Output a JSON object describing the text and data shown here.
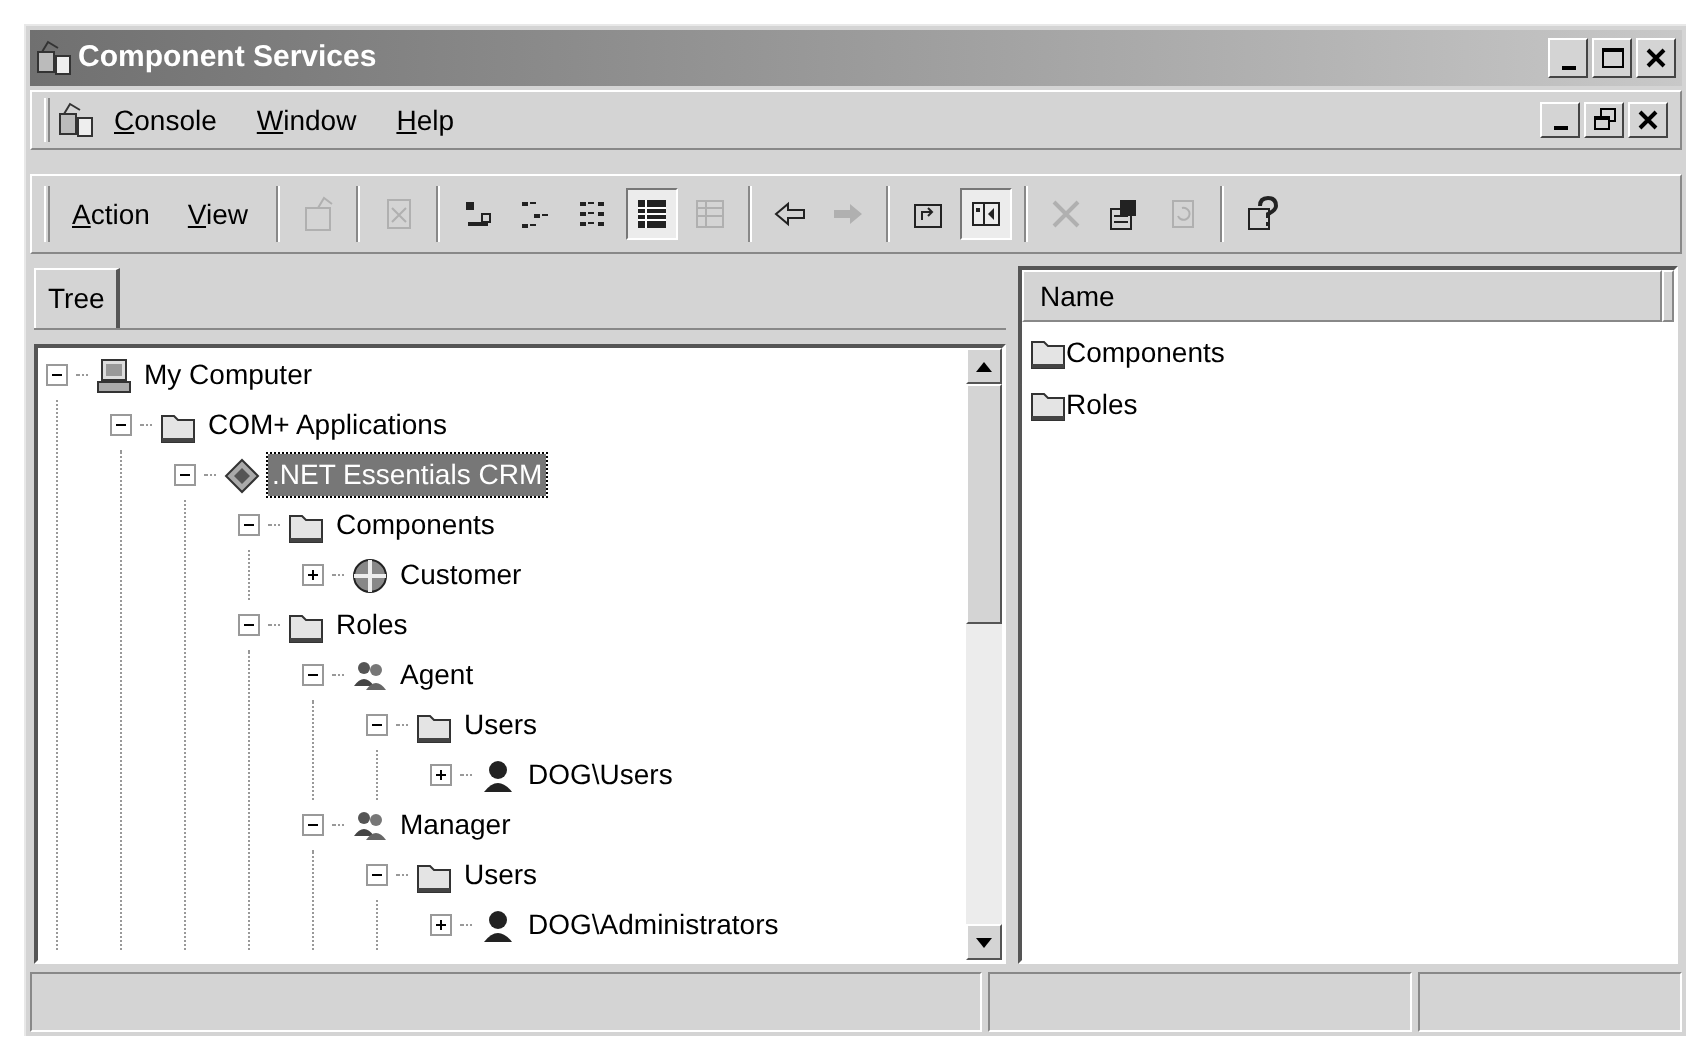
{
  "window": {
    "title": "Component Services",
    "controls": [
      {
        "kind": "minimize"
      },
      {
        "kind": "maximize"
      },
      {
        "kind": "close"
      }
    ]
  },
  "menu_bar": {
    "items": [
      {
        "label": "Console"
      },
      {
        "label": "Window"
      },
      {
        "label": "Help"
      }
    ],
    "child_controls": [
      {
        "kind": "minimize"
      },
      {
        "kind": "restore"
      },
      {
        "kind": "close"
      }
    ]
  },
  "toolbar": {
    "menus": [
      {
        "label": "Action"
      },
      {
        "label": "View"
      }
    ],
    "groups": [
      [
        {
          "kind": "new-window",
          "disabled": true,
          "pressed": false
        }
      ],
      [
        {
          "kind": "export",
          "disabled": true,
          "pressed": false
        }
      ],
      [
        {
          "kind": "large-icons",
          "disabled": false,
          "pressed": false
        },
        {
          "kind": "small-icons",
          "disabled": false,
          "pressed": false
        },
        {
          "kind": "list",
          "disabled": false,
          "pressed": false
        },
        {
          "kind": "details",
          "disabled": false,
          "pressed": true
        },
        {
          "kind": "customize",
          "disabled": true,
          "pressed": false
        }
      ],
      [
        {
          "kind": "back",
          "disabled": false,
          "pressed": false
        },
        {
          "kind": "forward",
          "disabled": true,
          "pressed": false
        }
      ],
      [
        {
          "kind": "up",
          "disabled": false,
          "pressed": false
        },
        {
          "kind": "show-tree",
          "disabled": false,
          "pressed": true
        }
      ],
      [
        {
          "kind": "delete",
          "disabled": true,
          "pressed": false
        },
        {
          "kind": "properties",
          "disabled": false,
          "pressed": false
        },
        {
          "kind": "refresh",
          "disabled": true,
          "pressed": false
        }
      ],
      [
        {
          "kind": "help",
          "disabled": false,
          "pressed": false
        }
      ]
    ]
  },
  "tree_tab": {
    "label": "Tree"
  },
  "tree": [
    {
      "label": "My Computer",
      "kind": "computer",
      "expanded": true,
      "selected": false,
      "children": [
        {
          "label": "COM+ Applications",
          "kind": "folder",
          "expanded": true,
          "selected": false,
          "children": [
            {
              "label": ".NET Essentials CRM",
              "kind": "application",
              "expanded": true,
              "selected": true,
              "children": [
                {
                  "label": "Components",
                  "kind": "folder",
                  "expanded": true,
                  "selected": false,
                  "children": [
                    {
                      "label": "Customer",
                      "kind": "component",
                      "expanded": false,
                      "selected": false
                    }
                  ]
                },
                {
                  "label": "Roles",
                  "kind": "folder",
                  "expanded": true,
                  "selected": false,
                  "children": [
                    {
                      "label": "Agent",
                      "kind": "role",
                      "expanded": true,
                      "selected": false,
                      "children": [
                        {
                          "label": "Users",
                          "kind": "folder",
                          "expanded": true,
                          "selected": false,
                          "children": [
                            {
                              "label": "DOG\\Users",
                              "kind": "user",
                              "expanded": false,
                              "selected": false
                            }
                          ]
                        }
                      ]
                    },
                    {
                      "label": "Manager",
                      "kind": "role",
                      "expanded": true,
                      "selected": false,
                      "children": [
                        {
                          "label": "Users",
                          "kind": "folder",
                          "expanded": true,
                          "selected": false,
                          "children": [
                            {
                              "label": "DOG\\Administrators",
                              "kind": "user",
                              "expanded": false,
                              "selected": false
                            }
                          ]
                        }
                      ]
                    }
                  ]
                }
              ]
            }
          ]
        }
      ]
    }
  ],
  "list_view": {
    "columns": [
      "Name"
    ],
    "items": [
      {
        "label": "Components",
        "kind": "folder"
      },
      {
        "label": "Roles",
        "kind": "folder"
      }
    ]
  }
}
